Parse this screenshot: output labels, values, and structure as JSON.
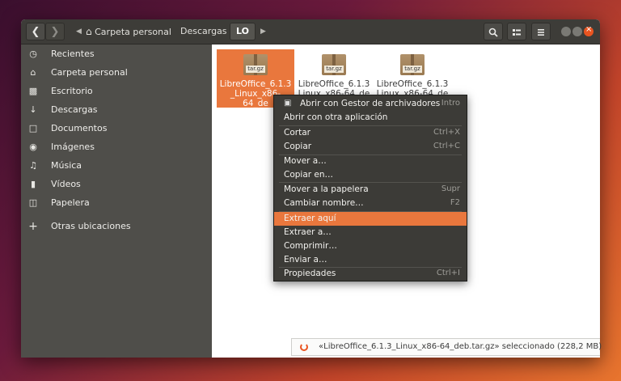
{
  "breadcrumb": {
    "home": "Carpeta personal",
    "downloads": "Descargas",
    "current": "LO"
  },
  "sidebar": {
    "items": [
      {
        "label": "Recientes",
        "icon": "clock-icon"
      },
      {
        "label": "Carpeta personal",
        "icon": "home-icon"
      },
      {
        "label": "Escritorio",
        "icon": "folder-icon"
      },
      {
        "label": "Descargas",
        "icon": "download-icon"
      },
      {
        "label": "Documentos",
        "icon": "document-icon"
      },
      {
        "label": "Imágenes",
        "icon": "camera-icon"
      },
      {
        "label": "Música",
        "icon": "music-icon"
      },
      {
        "label": "Vídeos",
        "icon": "video-icon"
      },
      {
        "label": "Papelera",
        "icon": "trash-icon"
      },
      {
        "label": "Otras ubicaciones",
        "icon": "plus-icon"
      }
    ]
  },
  "files": [
    {
      "name": "LibreOffice_6.1.3_Linux_x86-64_deb.tar.gz",
      "display": "LibreOffice_6.1.3\n_Linux_x86-64_de\nb.tar.gz",
      "tag": "tar.gz",
      "selected": true
    },
    {
      "name": "LibreOffice_6.1.3_Linux_x86-64_de",
      "display": "LibreOffice_6.1.3\nLinux_x86-64_de",
      "tag": "tar.gz",
      "selected": false
    },
    {
      "name": "LibreOffice_6.1.3_Linux_x86-64_de",
      "display": "LibreOffice_6.1.3\nLinux_x86-64_de",
      "tag": "tar.gz",
      "selected": false
    }
  ],
  "context_menu": {
    "items": [
      {
        "label": "Abrir con Gestor de archivadores",
        "accel": "Intro"
      },
      {
        "label": "Abrir con otra aplicación",
        "accel": ""
      },
      {
        "label": "Cortar",
        "accel": "Ctrl+X"
      },
      {
        "label": "Copiar",
        "accel": "Ctrl+C"
      },
      {
        "label": "Mover a…",
        "accel": ""
      },
      {
        "label": "Copiar en…",
        "accel": ""
      },
      {
        "label": "Mover a la papelera",
        "accel": "Supr"
      },
      {
        "label": "Cambiar nombre…",
        "accel": "F2"
      },
      {
        "label": "Extraer aquí",
        "accel": ""
      },
      {
        "label": "Extraer a…",
        "accel": ""
      },
      {
        "label": "Comprimir…",
        "accel": ""
      },
      {
        "label": "Enviar a…",
        "accel": ""
      },
      {
        "label": "Propiedades",
        "accel": "Ctrl+I"
      }
    ],
    "highlighted": "Extraer aquí"
  },
  "status": {
    "text": "«LibreOffice_6.1.3_Linux_x86-64_deb.tar.gz» seleccionado  (228,2 MB)"
  },
  "colors": {
    "accent": "#e95420",
    "selection": "#e9773d",
    "headerbar": "#3d3c38",
    "sidebar": "#4f4e4a",
    "menu": "#3c3b37"
  }
}
